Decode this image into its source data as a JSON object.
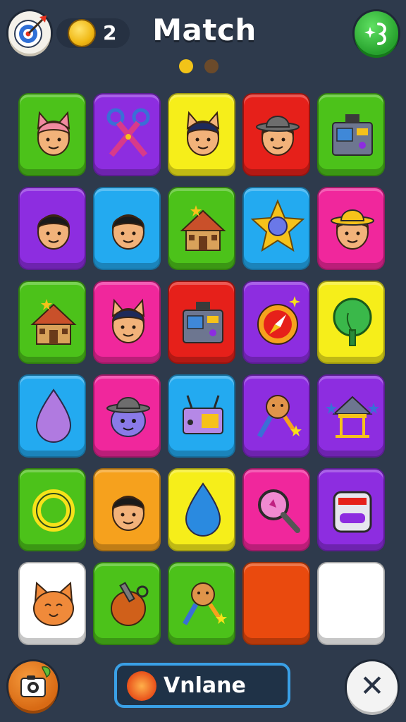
{
  "header": {
    "title": "Match",
    "coin_count": "2",
    "page_dots": [
      {
        "color": "#f2c318",
        "active": true
      },
      {
        "color": "#6b4a2a",
        "active": false
      }
    ]
  },
  "colors": {
    "background": "#2e3a4c",
    "green": "#4cc21a",
    "purple": "#8d2de0",
    "yellow": "#f6ee1a",
    "red": "#e6201a",
    "sky": "#23aaf0",
    "magenta": "#f0279c",
    "orange": "#f6a11d",
    "deep_orange": "#ea4a0e",
    "white": "#ffffff"
  },
  "tiles": [
    {
      "color": "green",
      "icon": "cat-ears-girl-icon"
    },
    {
      "color": "purple",
      "icon": "crossed-scissors-icon"
    },
    {
      "color": "yellow",
      "icon": "cat-ears-boy-icon"
    },
    {
      "color": "red",
      "icon": "hat-man-icon"
    },
    {
      "color": "green",
      "icon": "radio-device-icon"
    },
    {
      "color": "purple",
      "icon": "boy-face-icon"
    },
    {
      "color": "sky",
      "icon": "boy-face-icon"
    },
    {
      "color": "green",
      "icon": "house-icon"
    },
    {
      "color": "sky",
      "icon": "star-orb-icon"
    },
    {
      "color": "magenta",
      "icon": "straw-hat-person-icon"
    },
    {
      "color": "green",
      "icon": "house-icon"
    },
    {
      "color": "magenta",
      "icon": "cat-ears-boy-icon"
    },
    {
      "color": "red",
      "icon": "radio-device-icon"
    },
    {
      "color": "purple",
      "icon": "compass-icon"
    },
    {
      "color": "yellow",
      "icon": "tree-icon"
    },
    {
      "color": "sky",
      "icon": "water-drop-purple-icon"
    },
    {
      "color": "magenta",
      "icon": "hat-creature-icon"
    },
    {
      "color": "sky",
      "icon": "gadget-box-icon"
    },
    {
      "color": "purple",
      "icon": "puppet-toy-icon"
    },
    {
      "color": "purple",
      "icon": "gazebo-icon"
    },
    {
      "color": "green",
      "icon": "ring-icon"
    },
    {
      "color": "orange",
      "icon": "boy-face-icon"
    },
    {
      "color": "yellow",
      "icon": "water-drop-blue-icon"
    },
    {
      "color": "magenta",
      "icon": "magnifier-icon"
    },
    {
      "color": "purple",
      "icon": "tape-device-icon"
    },
    {
      "color": "white",
      "icon": "cat-face-icon"
    },
    {
      "color": "green",
      "icon": "pot-icon"
    },
    {
      "color": "green",
      "icon": "puppet-toy-icon"
    },
    {
      "color": "deep_orange",
      "icon": "none"
    },
    {
      "color": "white",
      "icon": "none"
    }
  ],
  "footer": {
    "word": "Vnlane",
    "close_symbol": "✕"
  }
}
